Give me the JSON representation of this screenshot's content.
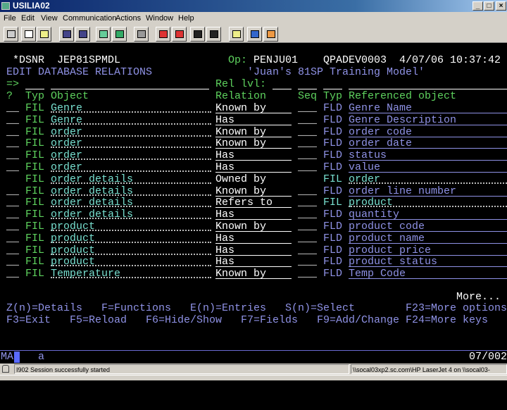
{
  "window": {
    "title": "USILIA02"
  },
  "menu": [
    "File",
    "Edit",
    "View",
    "Communication",
    "Actions",
    "Window",
    "Help"
  ],
  "toolbar": [
    "print-screen",
    "copy",
    "paste",
    "send",
    "receive",
    "display",
    "display-2",
    "keyboard",
    "record-macro",
    "stop-macro",
    "play-macro",
    "macro-2",
    "clipboard",
    "globe",
    "edit"
  ],
  "screen": {
    "program": "*DSNR",
    "model": "JEP81SPMDL",
    "op_label": "Op:",
    "user": "PENJU01",
    "device": "QPADEV0003",
    "date": "4/07/06",
    "time": "10:37:42",
    "title": "EDIT DATABASE RELATIONS",
    "model_name": "'Juan's 81SP Training Model'",
    "prompt": "=>",
    "rel_lvl_label": "Rel lvl:",
    "headers": {
      "sel": "?",
      "typ": "Typ",
      "object": "Object",
      "relation": "Relation",
      "seq": "Seq",
      "rtyp": "Typ",
      "robj": "Referenced object"
    },
    "rows": [
      {
        "sel": "__",
        "typ": "FIL",
        "object": "Genre",
        "relation": "Known by",
        "seq": "___",
        "rtyp": "FLD",
        "robj": "Genre Name"
      },
      {
        "sel": "__",
        "typ": "FIL",
        "object": "Genre",
        "relation": "Has",
        "seq": "___",
        "rtyp": "FLD",
        "robj": "Genre Description"
      },
      {
        "sel": "__",
        "typ": "FIL",
        "object": "order",
        "relation": "Known by",
        "seq": "___",
        "rtyp": "FLD",
        "robj": "order code"
      },
      {
        "sel": "__",
        "typ": "FIL",
        "object": "order",
        "relation": "Known by",
        "seq": "___",
        "rtyp": "FLD",
        "robj": "order date"
      },
      {
        "sel": "__",
        "typ": "FIL",
        "object": "order",
        "relation": "Has",
        "seq": "___",
        "rtyp": "FLD",
        "robj": "status"
      },
      {
        "sel": "__",
        "typ": "FIL",
        "object": "order",
        "relation": "Has",
        "seq": "___",
        "rtyp": "FLD",
        "robj": "value"
      },
      {
        "sel": "",
        "typ": "FIL",
        "object": "order details",
        "relation": "Owned by",
        "seq": "",
        "rtyp": "FIL",
        "robj": "order"
      },
      {
        "sel": "__",
        "typ": "FIL",
        "object": "order details",
        "relation": "Known by",
        "seq": "___",
        "rtyp": "FLD",
        "robj": "order line number"
      },
      {
        "sel": "__",
        "typ": "FIL",
        "object": "order details",
        "relation": "Refers to",
        "seq": "___",
        "rtyp": "FIL",
        "robj": "product"
      },
      {
        "sel": "__",
        "typ": "FIL",
        "object": "order details",
        "relation": "Has",
        "seq": "___",
        "rtyp": "FLD",
        "robj": "quantity"
      },
      {
        "sel": "__",
        "typ": "FIL",
        "object": "product",
        "relation": "Known by",
        "seq": "___",
        "rtyp": "FLD",
        "robj": "product code"
      },
      {
        "sel": "__",
        "typ": "FIL",
        "object": "product",
        "relation": "Has",
        "seq": "___",
        "rtyp": "FLD",
        "robj": "product name"
      },
      {
        "sel": "__",
        "typ": "FIL",
        "object": "product",
        "relation": "Has",
        "seq": "___",
        "rtyp": "FLD",
        "robj": "product price"
      },
      {
        "sel": "__",
        "typ": "FIL",
        "object": "product",
        "relation": "Has",
        "seq": "___",
        "rtyp": "FLD",
        "robj": "product status"
      },
      {
        "sel": "__",
        "typ": "FIL",
        "object": "Temperature",
        "relation": "Known by",
        "seq": "___",
        "rtyp": "FLD",
        "robj": "Temp Code"
      }
    ],
    "more": "More...",
    "options": [
      "Z(n)=Details",
      "F=Functions",
      "E(n)=Entries",
      "S(n)=Select",
      "F23=More options"
    ],
    "keys": [
      "F3=Exit",
      "F5=Reload",
      "F6=Hide/Show",
      "F7=Fields",
      "F9=Add/Change",
      "F24=More keys"
    ]
  },
  "oia": {
    "mode": "MA",
    "input": "a",
    "cursor_pos": "07/002"
  },
  "statusbar": {
    "message": "I902  Session successfully started",
    "printer": "\\\\socal03xp2.sc.com\\HP LaserJet 4 on \\\\socal03-"
  }
}
